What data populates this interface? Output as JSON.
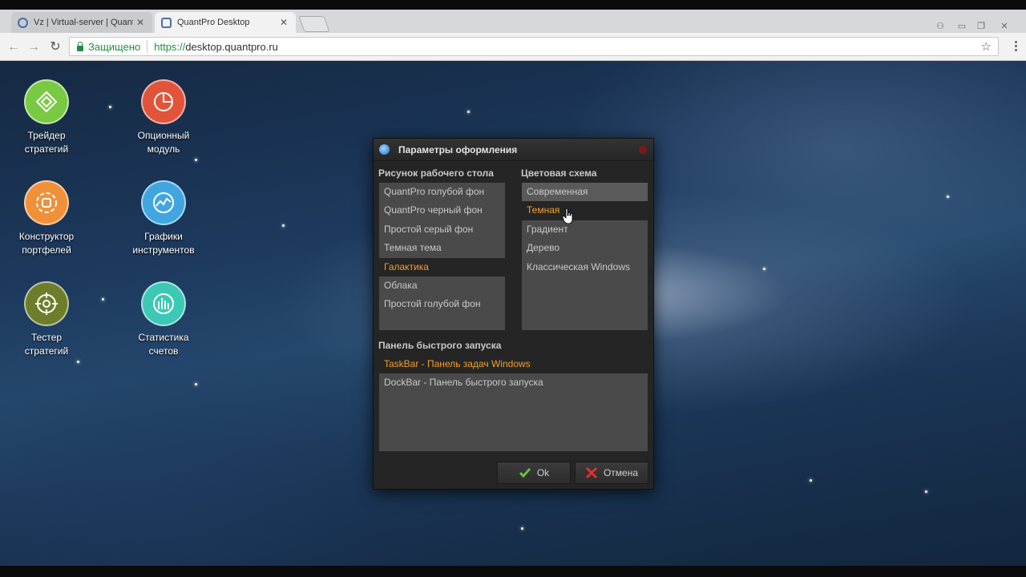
{
  "browser": {
    "tabs": [
      {
        "title": "Vz | Virtual-server | QuantP",
        "active": false
      },
      {
        "title": "QuantPro Desktop",
        "active": true
      }
    ],
    "address": {
      "secure_label": "Защищено",
      "scheme": "https://",
      "host": "desktop.quantpro.ru"
    }
  },
  "desktop_icons": [
    {
      "label": "Трейдер\nстратегий",
      "color": "#7ac943",
      "icon": "trader-icon"
    },
    {
      "label": "Опционный\nмодуль",
      "color": "#e2543a",
      "icon": "option-module-icon"
    },
    {
      "label": "Конструктор\nпортфелей",
      "color": "#f0913a",
      "icon": "portfolio-builder-icon"
    },
    {
      "label": "Графики\nинструментов",
      "color": "#3fa6e0",
      "icon": "charts-icon"
    },
    {
      "label": "Тестер\nстратегий",
      "color": "#6e7d2a",
      "icon": "tester-icon"
    },
    {
      "label": "Статистика\nсчетов",
      "color": "#3cc8b4",
      "icon": "account-stats-icon"
    }
  ],
  "dialog": {
    "title": "Параметры оформления",
    "wallpaper": {
      "heading": "Рисунок рабочего стола",
      "items": [
        "QuantPro голубой фон",
        "QuantPro черный фон",
        "Простой серый фон",
        "Темная тема",
        "Галактика",
        "Облака",
        "Простой голубой фон"
      ],
      "selected": 4
    },
    "color_scheme": {
      "heading": "Цветовая схема",
      "items": [
        "Современная",
        "Темная",
        "Градиент",
        "Дерево",
        "Классическая Windows"
      ],
      "selected": 1
    },
    "quick_launch": {
      "heading": "Панель быстрого запуска",
      "items": [
        "TaskBar - Панель задач Windows",
        "DockBar - Панель быстрого запуска"
      ],
      "selected": 0
    },
    "ok_label": "Ok",
    "cancel_label": "Отмена"
  },
  "colors": {
    "accent_selected": "#f0a030",
    "dialog_bg": "#252525",
    "list_bg": "#4a4a4a"
  }
}
